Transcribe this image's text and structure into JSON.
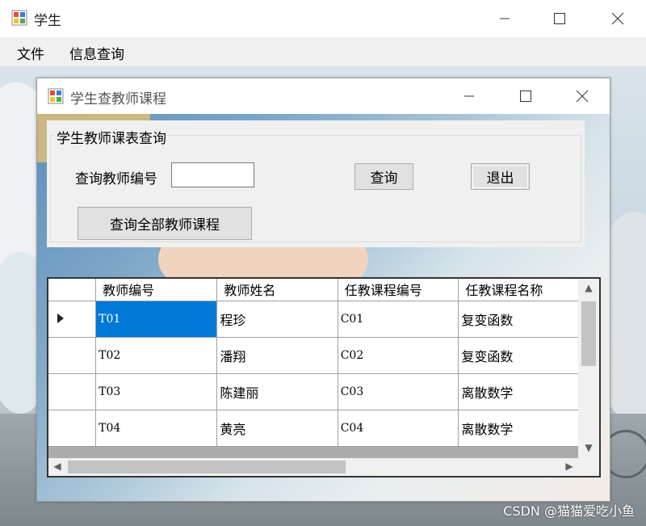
{
  "main_window": {
    "title": "学生",
    "menu": [
      "文件",
      "信息查询"
    ]
  },
  "dialog": {
    "title": "学生查教师课程",
    "group_title": "学生教师课表查询",
    "teacher_id_label": "查询教师编号",
    "teacher_id_value": "",
    "query_button": "查询",
    "exit_button": "退出",
    "query_all_button": "查询全部教师课程",
    "grid": {
      "columns": [
        "教师编号",
        "教师姓名",
        "任教课程编号",
        "任教课程名称"
      ],
      "rows": [
        [
          "T01",
          "程珍",
          "C01",
          "复变函数"
        ],
        [
          "T02",
          "潘翔",
          "C02",
          "复变函数"
        ],
        [
          "T03",
          "陈建丽",
          "C03",
          "离散数学"
        ],
        [
          "T04",
          "黄亮",
          "C04",
          "离散数学"
        ]
      ]
    }
  },
  "watermark": "CSDN @猫猫爱吃小鱼",
  "colors": {
    "selection": "#0078d7",
    "default_button_border": "#0078d7"
  }
}
